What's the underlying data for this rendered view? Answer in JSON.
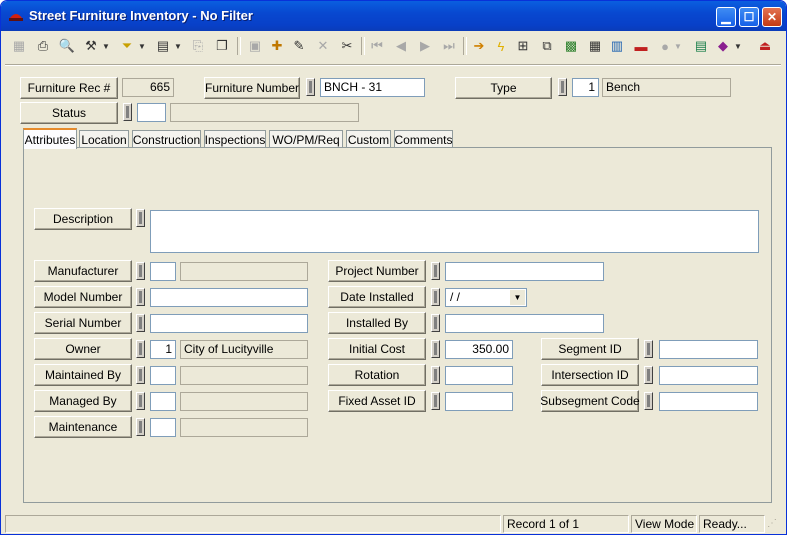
{
  "window": {
    "title": "Street Furniture Inventory - No Filter"
  },
  "header": {
    "rec_label": "Furniture Rec #",
    "rec_value": "665",
    "number_label": "Furniture Number",
    "number_value": "BNCH - 31",
    "type_label": "Type",
    "type_code": "1",
    "type_desc": "Bench",
    "status_label": "Status",
    "status_code": "",
    "status_desc": ""
  },
  "tabs": [
    "Attributes",
    "Location",
    "Construction",
    "Inspections",
    "WO/PM/Req",
    "Custom",
    "Comments"
  ],
  "form": {
    "description_label": "Description",
    "description_value": "",
    "manufacturer_label": "Manufacturer",
    "model_label": "Model Number",
    "serial_label": "Serial Number",
    "owner_label": "Owner",
    "owner_code": "1",
    "owner_desc": "City of Lucityville",
    "maintained_label": "Maintained By",
    "managed_label": "Managed By",
    "maintenance_label": "Maintenance",
    "project_label": "Project Number",
    "date_installed_label": "Date Installed",
    "date_installed_value": " / /",
    "installed_by_label": "Installed By",
    "initial_cost_label": "Initial Cost",
    "initial_cost_value": "350.00",
    "rotation_label": "Rotation",
    "fixed_asset_label": "Fixed Asset ID",
    "segment_label": "Segment ID",
    "intersection_label": "Intersection ID",
    "subsegment_label": "Subsegment Code"
  },
  "status": {
    "record": "Record 1 of 1",
    "mode": "View Mode",
    "state": "Ready..."
  }
}
